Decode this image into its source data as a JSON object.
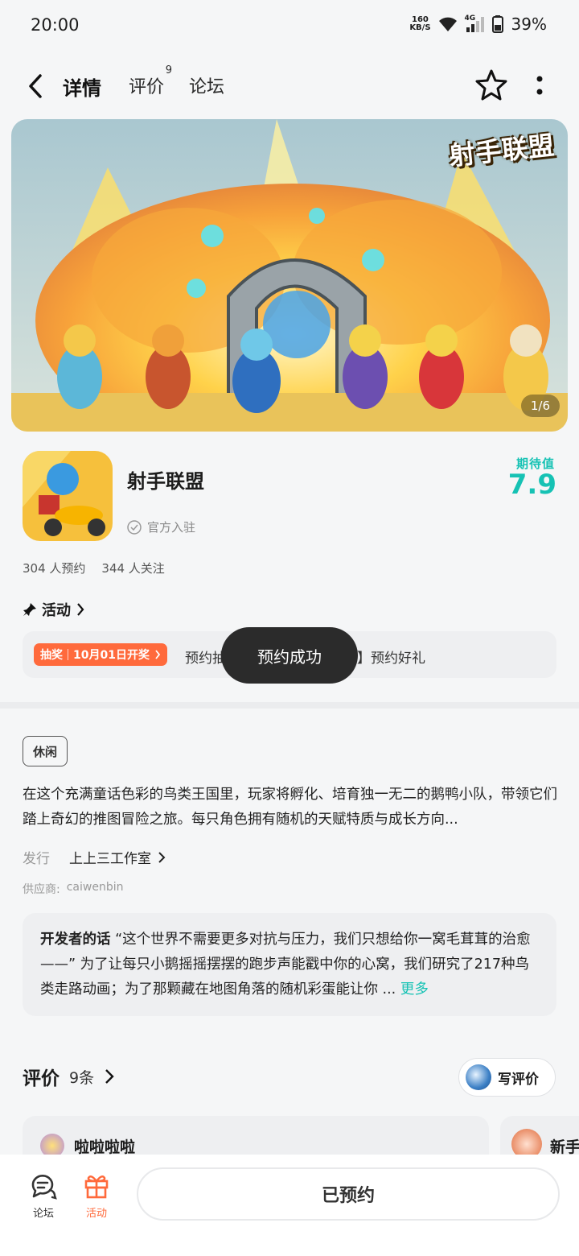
{
  "status_bar": {
    "time": "20:00",
    "net_speed_top": "160",
    "net_speed_bottom": "KB/S",
    "network_type": "4G",
    "battery": "39%"
  },
  "nav": {
    "tabs": [
      {
        "label": "详情",
        "active": true
      },
      {
        "label": "评价",
        "badge": "9"
      },
      {
        "label": "论坛"
      }
    ]
  },
  "banner": {
    "logo_text": "射手联盟",
    "counter": "1/6"
  },
  "app": {
    "name": "射手联盟",
    "official_label": "官方入驻",
    "expect_label": "期待值",
    "expect_score": "7.9",
    "reservations": "304 人预约",
    "followers": "344 人关注"
  },
  "activity": {
    "title": "活动",
    "badge_left": "抽奖",
    "badge_right": "10月01日开奖",
    "text_left": "预约抽",
    "text_right": "】预约好礼"
  },
  "toast": "预约成功",
  "detail": {
    "tag": "休闲",
    "description": "在这个充满童话色彩的鸟类王国里，玩家将孵化、培育独一无二的鹅鸭小队，带领它们踏上奇幻的推图冒险之旅。每只角色拥有随机的天赋特质与成长方向...",
    "publisher_label": "发行",
    "publisher": "上上三工作室",
    "supplier_label": "供应商:",
    "supplier": "caiwenbin"
  },
  "developer_note": {
    "title": "开发者的话",
    "text": "“这个世界不需要更多对抗与压力，我们只想给你一窝毛茸茸的治愈——” 为了让每只小鹅摇摇摆摆的跑步声能戳中你的心窝，我们研究了217种鸟类走路动画；为了那颗藏在地图角落的随机彩蛋能让你 ...",
    "more": "更多"
  },
  "reviews": {
    "title": "评价",
    "count": "9条",
    "write_label": "写评价",
    "cards": [
      {
        "name": "啦啦啦啦"
      },
      {
        "name": "新手"
      }
    ]
  },
  "bottom_bar": {
    "forum_label": "论坛",
    "activity_label": "活动",
    "reserved_label": "已预约"
  },
  "colors": {
    "accent": "#16c2b4",
    "orange": "#ff6a3c"
  }
}
